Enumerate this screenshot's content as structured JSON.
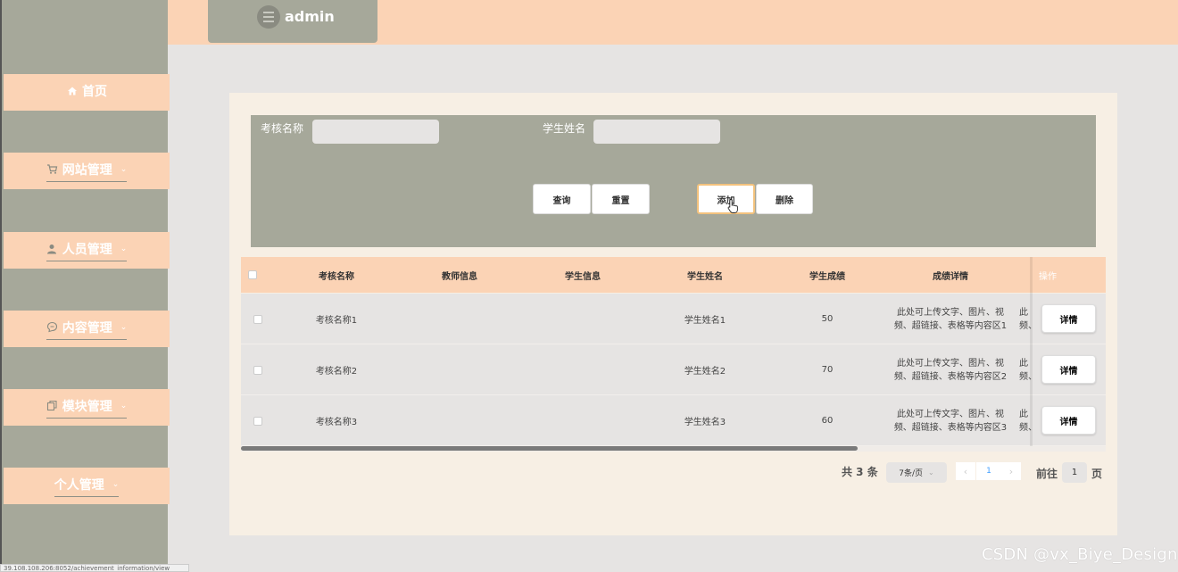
{
  "header": {
    "username": "admin"
  },
  "sidebar": {
    "items": [
      {
        "label": "首页",
        "icon": "home-icon"
      },
      {
        "label": "网站管理",
        "icon": "cart-icon"
      },
      {
        "label": "人员管理",
        "icon": "user-icon"
      },
      {
        "label": "内容管理",
        "icon": "chat-icon"
      },
      {
        "label": "模块管理",
        "icon": "copy-icon"
      },
      {
        "label": "个人管理",
        "icon": ""
      }
    ]
  },
  "search": {
    "field1_label": "考核名称",
    "field2_label": "学生姓名",
    "field1_value": "",
    "field2_value": "",
    "query_btn": "查询",
    "reset_btn": "重置",
    "add_btn": "添加",
    "delete_btn": "删除"
  },
  "table": {
    "columns": [
      "考核名称",
      "教师信息",
      "学生信息",
      "学生姓名",
      "学生成绩",
      "成绩详情",
      "操作"
    ],
    "rows": [
      {
        "name": "考核名称1",
        "teacher": "",
        "student": "",
        "student_name": "学生姓名1",
        "score": "50",
        "detail_l1": "此处可上传文字、图片、视",
        "detail_l2": "频、超链接、表格等内容区1",
        "extra_l1": "此",
        "extra_l2": "频、",
        "action": "详情"
      },
      {
        "name": "考核名称2",
        "teacher": "",
        "student": "",
        "student_name": "学生姓名2",
        "score": "70",
        "detail_l1": "此处可上传文字、图片、视",
        "detail_l2": "频、超链接、表格等内容区2",
        "extra_l1": "此",
        "extra_l2": "频、",
        "action": "详情"
      },
      {
        "name": "考核名称3",
        "teacher": "",
        "student": "",
        "student_name": "学生姓名3",
        "score": "60",
        "detail_l1": "此处可上传文字、图片、视",
        "detail_l2": "频、超链接、表格等内容区3",
        "extra_l1": "此",
        "extra_l2": "频、",
        "action": "详情"
      }
    ]
  },
  "pagination": {
    "total": "共 3 条",
    "page_size": "7条/页",
    "current_page": "1",
    "goto_prefix": "前往",
    "goto_value": "1",
    "goto_suffix": "页"
  },
  "watermark": "CSDN @vx_Biye_Design",
  "statusbar": "39.108.108.206:8052/achievement_information/view"
}
